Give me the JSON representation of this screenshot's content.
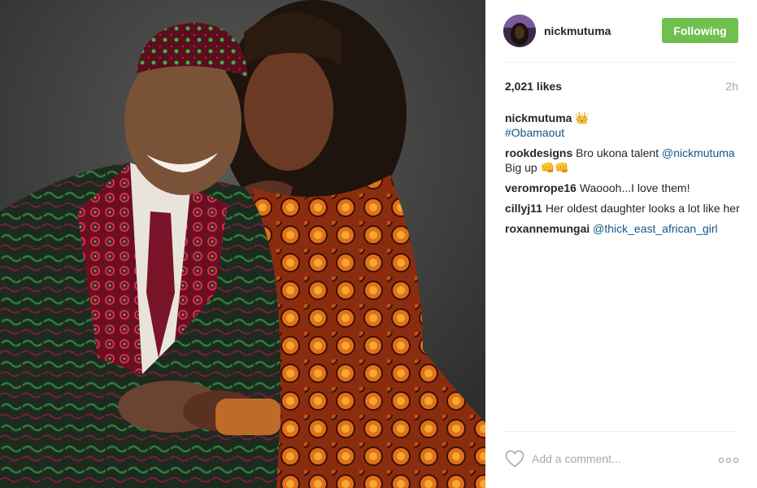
{
  "post": {
    "image_alt": "",
    "username": "nickmutuma",
    "follow_label": "Following",
    "likes": "2,021 likes",
    "time": "2h",
    "caption": {
      "user": "nickmutuma",
      "emoji": "👑",
      "hashtag": "#Obamaout"
    },
    "comments": [
      {
        "user": "rookdesigns",
        "text": " Bro ukona talent ",
        "mention": "@nickmutuma",
        "after": " Big up 👊👊"
      },
      {
        "user": "veromrope16",
        "text": " Waoooh...I love them!"
      },
      {
        "user": "cillyj11",
        "text": " Her oldest daughter looks a lot like her"
      },
      {
        "user": "roxannemungai",
        "text": " ",
        "mention": "@thick_east_african_girl"
      }
    ],
    "add_comment_placeholder": "Add a comment...",
    "icons": {
      "like": "heart-icon",
      "more": "more-options-icon"
    }
  }
}
